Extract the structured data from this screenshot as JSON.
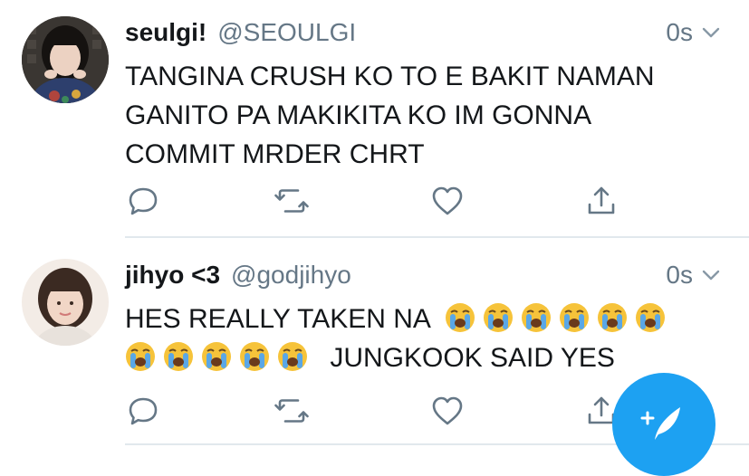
{
  "tweets": [
    {
      "name": "seulgi!",
      "handle": "@SEOULGI",
      "time": "0s",
      "text": "TANGINA CRUSH KO TO E BAKIT NAMAN GANITO PA MAKIKITA KO IM GONNA COMMIT MRDER CHRT"
    },
    {
      "name": "jihyo <3",
      "handle": "@godjihyo",
      "time": "0s",
      "text_line1_prefix": "HES REALLY TAKEN NA",
      "text_line2_suffix": "JUNGKOOK SAID YES",
      "emoji_line1_count": 6,
      "emoji_line2_count": 5,
      "emoji": "loudly-crying-face"
    }
  ],
  "icons": {
    "reply": "reply-icon",
    "retweet": "retweet-icon",
    "like": "heart-icon",
    "share": "share-icon",
    "caret": "chevron-down-icon",
    "compose": "compose-tweet-icon"
  },
  "colors": {
    "accent": "#1da1f2",
    "secondary_text": "#657786",
    "icon": "#657786",
    "divider": "#e1e8ed"
  }
}
